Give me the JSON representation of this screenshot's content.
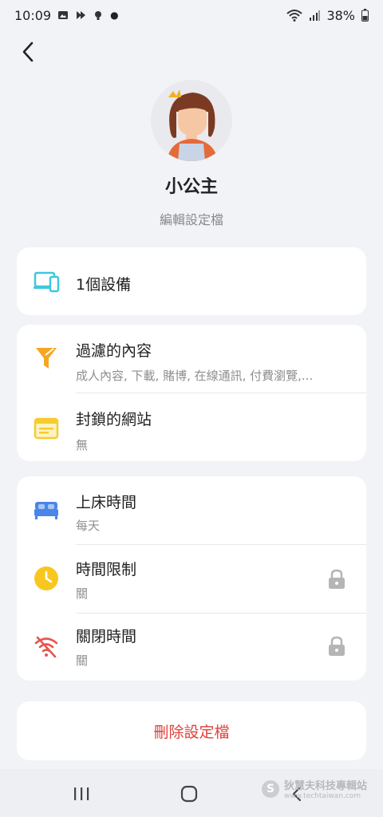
{
  "status_bar": {
    "time": "10:09",
    "battery": "38%"
  },
  "profile": {
    "name": "小公主",
    "edit_label": "編輯設定檔"
  },
  "devices": {
    "label": "1個設備"
  },
  "filters": {
    "content_title": "過濾的內容",
    "content_sub": "成人內容, 下載, 賭博, 在線通訊, 付費瀏覽,...",
    "sites_title": "封鎖的網站",
    "sites_sub": "無"
  },
  "schedule": {
    "bedtime_title": "上床時間",
    "bedtime_sub": "每天",
    "limit_title": "時間限制",
    "limit_sub": "關",
    "offtime_title": "關閉時間",
    "offtime_sub": "關"
  },
  "delete_label": "刪除設定檔",
  "watermark": {
    "badge": "S",
    "text": "狄慧夫科技專輯站",
    "url": "www.techtaiwan.com"
  },
  "colors": {
    "device_icon": "#3fc6e0",
    "filter_icon": "#f5a623",
    "sites_icon": "#f6cc2e",
    "bed_icon": "#4a86e8",
    "clock_icon": "#f8c71f",
    "wifi_off_icon": "#e85550",
    "delete_text": "#e0403a"
  }
}
